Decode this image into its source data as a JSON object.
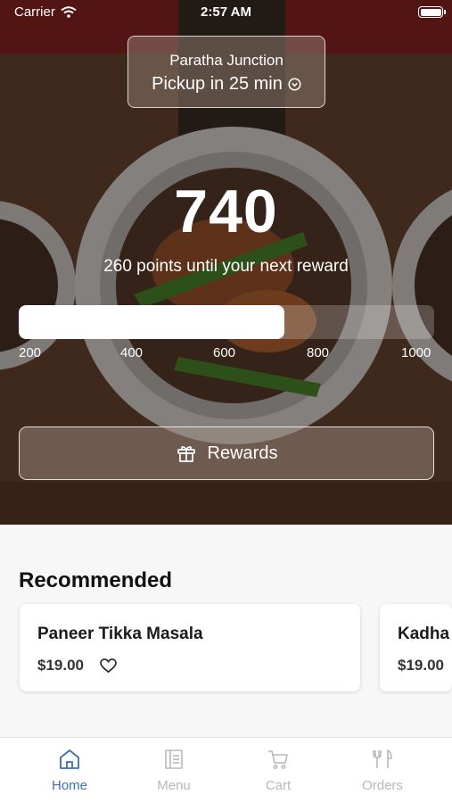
{
  "status_bar": {
    "carrier": "Carrier",
    "time": "2:57 AM"
  },
  "store": {
    "name": "Paratha Junction",
    "pickup": "Pickup in 25 min"
  },
  "rewards": {
    "points": "740",
    "subtitle": "260 points until your next reward",
    "progress_fraction": 0.64,
    "ticks": [
      "200",
      "400",
      "600",
      "800",
      "1000"
    ],
    "button_label": "Rewards"
  },
  "recommended": {
    "title": "Recommended",
    "items": [
      {
        "name": "Paneer Tikka Masala",
        "price": "$19.00"
      },
      {
        "name": "Kadha",
        "price": "$19.00"
      }
    ]
  },
  "tabs": [
    {
      "label": "Home",
      "icon": "home-icon",
      "active": true
    },
    {
      "label": "Menu",
      "icon": "menu-icon",
      "active": false
    },
    {
      "label": "Cart",
      "icon": "cart-icon",
      "active": false
    },
    {
      "label": "Orders",
      "icon": "orders-icon",
      "active": false
    }
  ],
  "colors": {
    "accent": "#3b6fb5",
    "tab_inactive": "#b8b8b8"
  }
}
